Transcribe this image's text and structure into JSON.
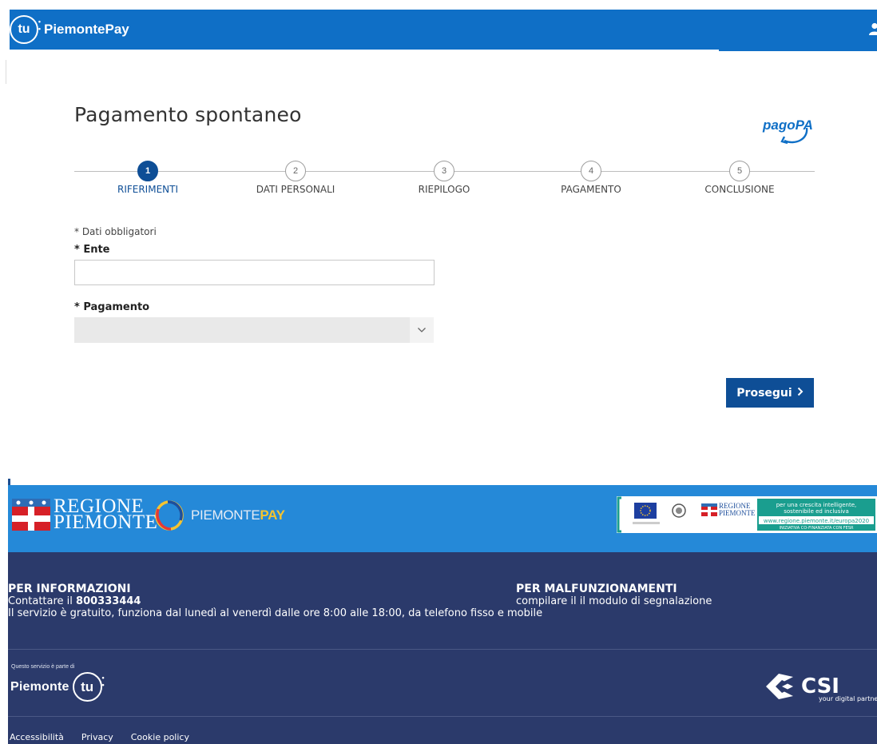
{
  "header": {
    "brand_icon_text": "tu",
    "brand_name": "PiemontePay"
  },
  "main": {
    "title": "Pagamento spontaneo",
    "pagopa_logo_text": "pagoPA",
    "steps": [
      {
        "number": "1",
        "label": "RIFERIMENTI",
        "active": true
      },
      {
        "number": "2",
        "label": "DATI PERSONALI",
        "active": false
      },
      {
        "number": "3",
        "label": "RIEPILOGO",
        "active": false
      },
      {
        "number": "4",
        "label": "PAGAMENTO",
        "active": false
      },
      {
        "number": "5",
        "label": "CONCLUSIONE",
        "active": false
      }
    ],
    "required_note": "* Dati obbligatori",
    "ente": {
      "label": "* Ente",
      "value": "",
      "placeholder": ""
    },
    "pagamento": {
      "label": "* Pagamento",
      "selected": ""
    },
    "submit_label": "Prosegui"
  },
  "footer": {
    "regione_line1": "REGIONE",
    "regione_line2": "PIEMONTE",
    "piemontepay_part1": "PIEMONTE",
    "piemontepay_part2": "PAY",
    "eu_regione_line1": "REGIONE",
    "eu_regione_line2": "PIEMONTE",
    "eu_slogan_line1": "per una crescita intelligente,",
    "eu_slogan_line2": "sostenibile ed inclusiva",
    "eu_url": "www.regione.piemonte.it/europa2020",
    "eu_cofinance": "INIZIATIVA CO-FINANZIATA CON FESR",
    "info_title": "PER INFORMAZIONI",
    "info_contact_prefix": "Contattare il ",
    "info_phone": "800333444",
    "info_hours": "Il servizio è gratuito, funziona dal lunedì al venerdì dalle ore 8:00 alle 18:00, da telefono fisso e mobile",
    "malf_title": "PER MALFUNZIONAMENTI",
    "malf_text": "compilare il il modulo di segnalazione",
    "service_note": "Questo servizio è parte di",
    "piemonte_tu_text": "Piemonte",
    "piemonte_tu_icon": "tu",
    "csi_name": "CSI",
    "csi_tagline": "your digital partner",
    "links": [
      "Accessibilità",
      "Privacy",
      "Cookie policy"
    ]
  },
  "colors": {
    "header_blue": "#0f6fc6",
    "primary": "#0e4e96",
    "footer_blue": "#2589d8",
    "footer_dark": "#2b3a6b"
  }
}
